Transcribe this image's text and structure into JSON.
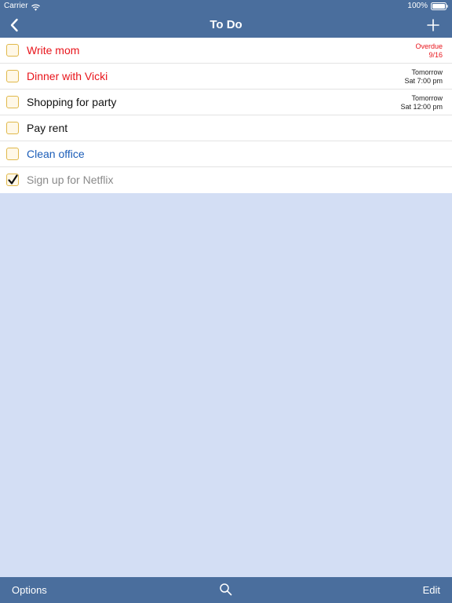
{
  "status_bar": {
    "carrier": "Carrier",
    "battery": "100%"
  },
  "nav": {
    "title": "To Do"
  },
  "colors": {
    "header_bg": "#4a6e9d",
    "list_bg": "#ffffff",
    "empty_bg": "#d3def4",
    "overdue_red": "#e8141b",
    "blue_task": "#1b5db8",
    "completed_gray": "#8a8a8a",
    "checkbox_border": "#e0b84a"
  },
  "tasks": [
    {
      "title": "Write mom",
      "color": "#e8141b",
      "checked": false,
      "due_line1": "Overdue",
      "due_line2": "9/16",
      "due_color": "#e8141b"
    },
    {
      "title": "Dinner with Vicki",
      "color": "#e8141b",
      "checked": false,
      "due_line1": "Tomorrow",
      "due_line2": "Sat 7:00 pm",
      "due_color": "#222222"
    },
    {
      "title": "Shopping for party",
      "color": "#111111",
      "checked": false,
      "due_line1": "Tomorrow",
      "due_line2": "Sat 12:00 pm",
      "due_color": "#222222"
    },
    {
      "title": "Pay rent",
      "color": "#111111",
      "checked": false,
      "due_line1": "",
      "due_line2": "",
      "due_color": "#222222"
    },
    {
      "title": "Clean office",
      "color": "#1b5db8",
      "checked": false,
      "due_line1": "",
      "due_line2": "",
      "due_color": "#222222"
    },
    {
      "title": "Sign up for Netflix",
      "color": "#8a8a8a",
      "checked": true,
      "due_line1": "",
      "due_line2": "",
      "due_color": "#222222"
    }
  ],
  "toolbar": {
    "options_label": "Options",
    "search_icon": "search-icon",
    "edit_label": "Edit"
  }
}
